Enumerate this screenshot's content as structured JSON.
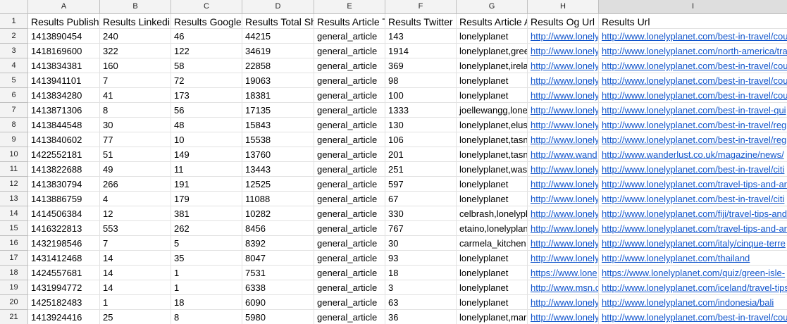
{
  "columns": [
    {
      "letter": "A",
      "width": 102
    },
    {
      "letter": "B",
      "width": 101
    },
    {
      "letter": "C",
      "width": 101
    },
    {
      "letter": "D",
      "width": 102
    },
    {
      "letter": "E",
      "width": 101
    },
    {
      "letter": "F",
      "width": 101
    },
    {
      "letter": "G",
      "width": 101
    },
    {
      "letter": "H",
      "width": 101
    },
    {
      "letter": "I",
      "width": 268
    }
  ],
  "link_columns": [
    7,
    8
  ],
  "rows": [
    {
      "num": "1",
      "cells": [
        "Results Publish",
        "Results Linkedin",
        "Results Google P",
        "Results Total Sh",
        "Results Article Ty",
        "Results Twitter S",
        "Results Article A",
        "Results Og Url",
        "Results Url"
      ]
    },
    {
      "num": "2",
      "cells": [
        "1413890454",
        "240",
        "46",
        "44215",
        "general_article",
        "143",
        "lonelyplanet",
        "http://www.lonely",
        "http://www.lonelyplanet.com/best-in-travel/cou"
      ]
    },
    {
      "num": "3",
      "cells": [
        "1418169600",
        "322",
        "122",
        "34619",
        "general_article",
        "1914",
        "lonelyplanet,gree",
        "http://www.lonely",
        "http://www.lonelyplanet.com/north-america/tra"
      ]
    },
    {
      "num": "4",
      "cells": [
        "1413834381",
        "160",
        "58",
        "22858",
        "general_article",
        "369",
        "lonelyplanet,irela",
        "http://www.lonely",
        "http://www.lonelyplanet.com/best-in-travel/cou"
      ]
    },
    {
      "num": "5",
      "cells": [
        "1413941101",
        "7",
        "72",
        "19063",
        "general_article",
        "98",
        "lonelyplanet",
        "http://www.lonely",
        "http://www.lonelyplanet.com/best-in-travel/cou"
      ]
    },
    {
      "num": "6",
      "cells": [
        "1413834280",
        "41",
        "173",
        "18381",
        "general_article",
        "100",
        "lonelyplanet",
        "http://www.lonely",
        "http://www.lonelyplanet.com/best-in-travel/cou"
      ]
    },
    {
      "num": "7",
      "cells": [
        "1413871306",
        "8",
        "56",
        "17135",
        "general_article",
        "1333",
        "joellewangg,lone",
        "http://www.lonely",
        "http://www.lonelyplanet.com/best-in-travel-qui"
      ]
    },
    {
      "num": "8",
      "cells": [
        "1413844548",
        "30",
        "48",
        "15843",
        "general_article",
        "130",
        "lonelyplanet,elus",
        "http://www.lonely",
        "http://www.lonelyplanet.com/best-in-travel/reg"
      ]
    },
    {
      "num": "9",
      "cells": [
        "1413840602",
        "77",
        "10",
        "15538",
        "general_article",
        "106",
        "lonelyplanet,tasn",
        "http://www.lonely",
        "http://www.lonelyplanet.com/best-in-travel/reg"
      ]
    },
    {
      "num": "10",
      "cells": [
        "1422552181",
        "51",
        "149",
        "13760",
        "general_article",
        "201",
        "lonelyplanet,tasn",
        "http://www.wand",
        "http://www.wanderlust.co.uk/magazine/news/"
      ]
    },
    {
      "num": "11",
      "cells": [
        "1413822688",
        "49",
        "11",
        "13443",
        "general_article",
        "251",
        "lonelyplanet,was",
        "http://www.lonely",
        "http://www.lonelyplanet.com/best-in-travel/citi"
      ]
    },
    {
      "num": "12",
      "cells": [
        "1413830794",
        "266",
        "191",
        "12525",
        "general_article",
        "597",
        "lonelyplanet",
        "http://www.lonely",
        "http://www.lonelyplanet.com/travel-tips-and-ar"
      ]
    },
    {
      "num": "13",
      "cells": [
        "1413886759",
        "4",
        "179",
        "11088",
        "general_article",
        "67",
        "lonelyplanet",
        "http://www.lonely",
        "http://www.lonelyplanet.com/best-in-travel/citi"
      ]
    },
    {
      "num": "14",
      "cells": [
        "1414506384",
        "12",
        "381",
        "10282",
        "general_article",
        "330",
        "celbrash,lonelypl",
        "http://www.lonely",
        "http://www.lonelyplanet.com/fiji/travel-tips-and"
      ]
    },
    {
      "num": "15",
      "cells": [
        "1416322813",
        "553",
        "262",
        "8456",
        "general_article",
        "767",
        "etaino,lonelyplan",
        "http://www.lonely",
        "http://www.lonelyplanet.com/travel-tips-and-ar"
      ]
    },
    {
      "num": "16",
      "cells": [
        "1432198546",
        "7",
        "5",
        "8392",
        "general_article",
        "30",
        "carmela_kitchen",
        "http://www.lonely",
        "http://www.lonelyplanet.com/italy/cinque-terre"
      ]
    },
    {
      "num": "17",
      "cells": [
        "1431412468",
        "14",
        "35",
        "8047",
        "general_article",
        "93",
        "lonelyplanet",
        "http://www.lonely",
        "http://www.lonelyplanet.com/thailand"
      ]
    },
    {
      "num": "18",
      "cells": [
        "1424557681",
        "14",
        "1",
        "7531",
        "general_article",
        "18",
        "lonelyplanet",
        "https://www.lone",
        "https://www.lonelyplanet.com/quiz/green-isle-"
      ]
    },
    {
      "num": "19",
      "cells": [
        "1431994772",
        "14",
        "1",
        "6338",
        "general_article",
        "3",
        "lonelyplanet",
        "http://www.msn.c",
        "http://www.lonelyplanet.com/iceland/travel-tips"
      ]
    },
    {
      "num": "20",
      "cells": [
        "1425182483",
        "1",
        "18",
        "6090",
        "general_article",
        "63",
        "lonelyplanet",
        "http://www.lonely",
        "http://www.lonelyplanet.com/indonesia/bali"
      ]
    },
    {
      "num": "21",
      "cells": [
        "1413924416",
        "25",
        "8",
        "5980",
        "general_article",
        "36",
        "lonelyplanet,mar",
        "http://www.lonely",
        "http://www.lonelyplanet.com/best-in-travel/cou"
      ]
    }
  ]
}
